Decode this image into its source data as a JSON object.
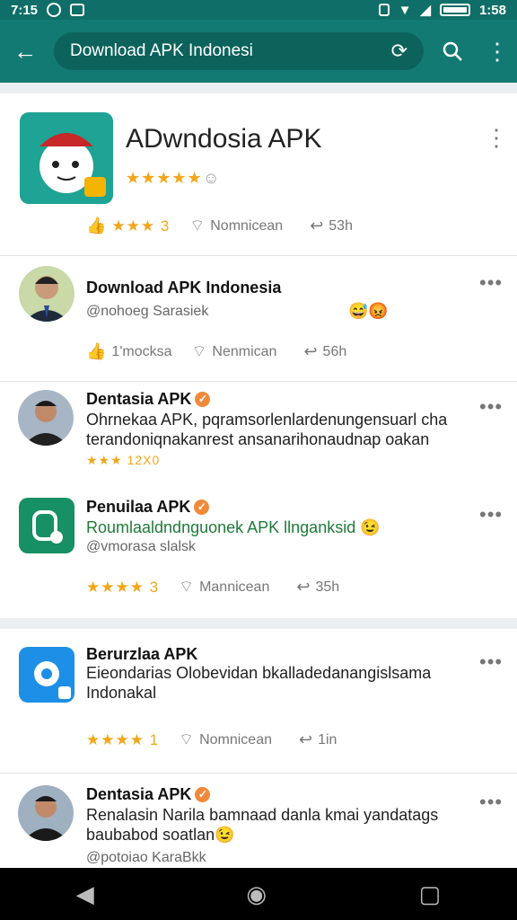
{
  "status": {
    "time": "7:15",
    "clock_right": "1:58"
  },
  "toolbar": {
    "back_icon": "back-arrow-icon",
    "search_text": "Download APK Indonesi",
    "search_icon": "search-icon",
    "more_icon": "more-vert-icon"
  },
  "header": {
    "title": "ADwndosia APK",
    "rating_stars": "★★★★★",
    "actions": {
      "like": "★★★ 3",
      "comment": "Nomnicean",
      "share": "53h"
    }
  },
  "posts": [
    {
      "title": "Download APK Indonesia",
      "sub": "@nohoeg Sarasiek",
      "emoji": "😅😡",
      "actions": {
        "like": "1'mocksa",
        "comment": "Nenmican",
        "share": "56h"
      }
    },
    {
      "title": "Dentasia APK",
      "body": "Ohrnekaa APK, pqramsorlenlardenungensuarl cha terandoniqnakanrest ansanarihonaudnap oakan",
      "rating": "★★★ 12X0"
    },
    {
      "title": "Penuilaa APK",
      "body": "Roumlaaldndnguonek APK llnganksid 😉",
      "sub": "@vmorasa slalsk",
      "actions": {
        "like": "★★★★ 3",
        "comment": "Mannicean",
        "share": "35h"
      }
    },
    {
      "title": "Berurzlaa APK",
      "body": "Eieondarias Olobevidan bkalladedanangislsama Indonakal",
      "actions": {
        "like": "★★★★ 1",
        "comment": "Nomnicean",
        "share": "1in"
      }
    },
    {
      "title": "Dentasia APK",
      "body": "Renalasin Narila bamnaad danla kmai yandatags baubabod soatlan😉",
      "sub": "@potoiao KaraBkk"
    }
  ],
  "colors": {
    "accent": "#127a72",
    "star": "#f2a619",
    "verified": "#f08a3a"
  }
}
